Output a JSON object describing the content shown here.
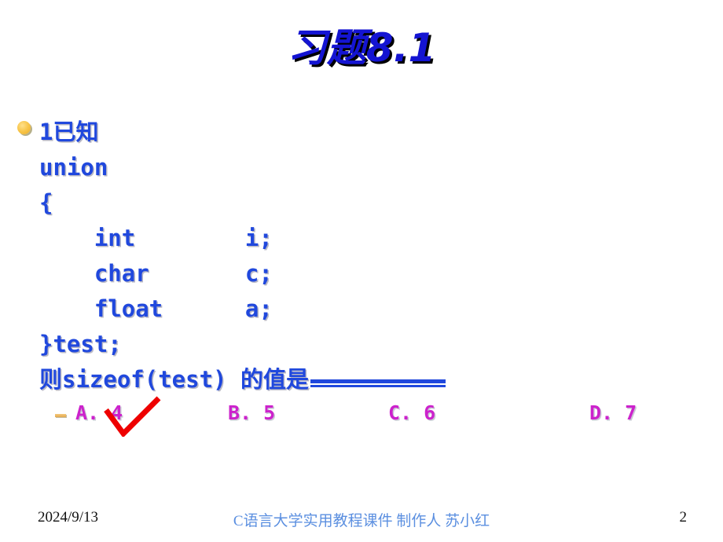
{
  "slide": {
    "title": "习题8.1",
    "background_color": "#ffffff",
    "title_color": "#1414d2",
    "title_shadow_color": "#000000"
  },
  "content": {
    "bullet_icon": "gold-disc-bullet",
    "code_color": "#2048dd",
    "lines": [
      "1已知",
      "union",
      "{",
      "    int        i;",
      "    char       c;",
      "    float      a;",
      "}test;"
    ],
    "question_prefix": "则sizeof(test) 的值是",
    "blank_line": "__________"
  },
  "options": {
    "dash_bullet_icon": "small-dash-bullet",
    "color": "#cc22cc",
    "items": [
      {
        "label": "A. 4",
        "selected": true
      },
      {
        "label": "B. 5",
        "selected": false
      },
      {
        "label": "C. 6",
        "selected": false
      },
      {
        "label": "D. 7",
        "selected": false
      }
    ],
    "check_mark_icon": "red-check-icon",
    "check_mark_color": "#ee0000"
  },
  "footer": {
    "date": "2024/9/13",
    "center_text": "C语言大学实用教程课件 制作人 苏小红",
    "center_color": "#5b8fe0",
    "page_number": "2"
  }
}
